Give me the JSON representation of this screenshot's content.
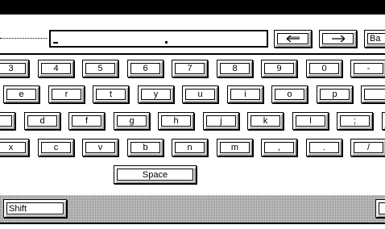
{
  "input": {
    "value": " "
  },
  "nav": {
    "back_icon": "left-arrow-icon",
    "forward_icon": "right-arrow-icon",
    "backspace_label": "Ba"
  },
  "keyboard": {
    "rows": [
      [
        "3",
        "4",
        "5",
        "6",
        "7",
        "8",
        "9",
        "0",
        "-"
      ],
      [
        "e",
        "r",
        "t",
        "y",
        "u",
        "i",
        "o",
        "p",
        ""
      ],
      [
        "",
        "d",
        "f",
        "g",
        "h",
        "j",
        "k",
        "l",
        ";",
        ""
      ],
      [
        "x",
        "c",
        "v",
        "b",
        "n",
        "m",
        ",",
        ".",
        "/"
      ]
    ],
    "space_label": "Space",
    "shift_label": "Shift"
  }
}
